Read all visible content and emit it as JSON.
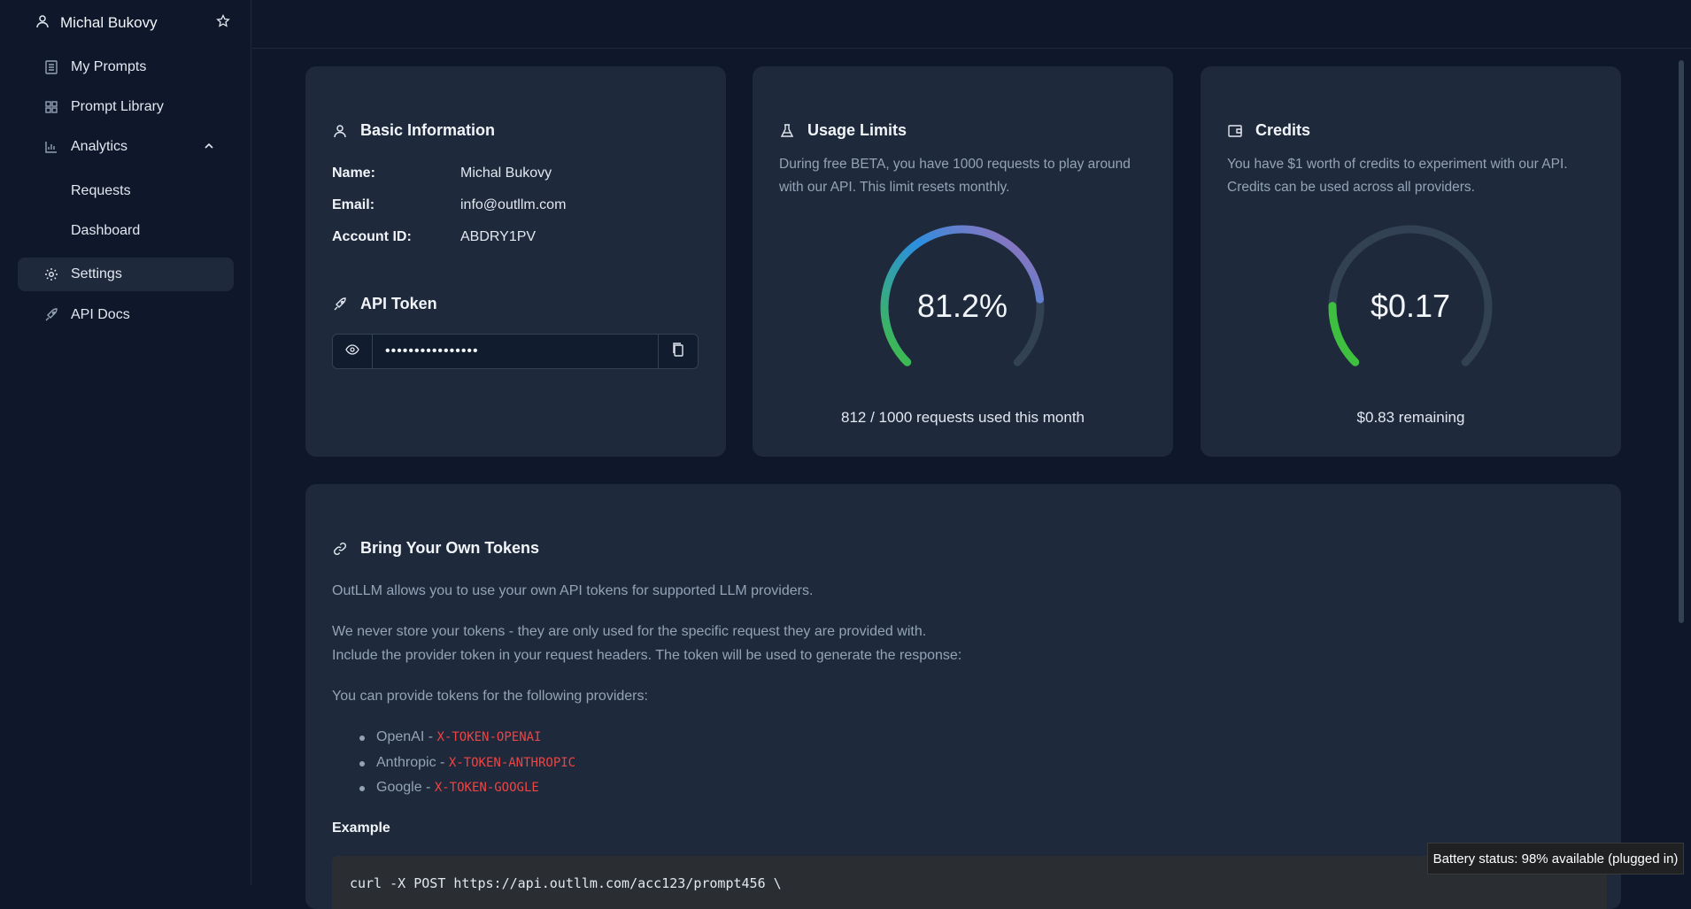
{
  "sidebar": {
    "user_name": "Michal Bukovy",
    "items": [
      {
        "label": "My Prompts",
        "icon": "document-icon"
      },
      {
        "label": "Prompt Library",
        "icon": "grid-icon"
      },
      {
        "label": "Analytics",
        "icon": "bar-chart-icon",
        "expanded": true
      },
      {
        "label": "Requests"
      },
      {
        "label": "Dashboard"
      },
      {
        "label": "Settings",
        "icon": "gear-icon",
        "active": true
      },
      {
        "label": "API Docs",
        "icon": "rocket-icon"
      }
    ]
  },
  "basic_info": {
    "title": "Basic Information",
    "name_label": "Name:",
    "name_value": "Michal Bukovy",
    "email_label": "Email:",
    "email_value": "info@outllm.com",
    "account_label": "Account ID:",
    "account_value": "ABDRY1PV",
    "api_token_title": "API Token",
    "api_token_value": "••••••••••••••••"
  },
  "usage": {
    "title": "Usage Limits",
    "description": "During free BETA, you have 1000 requests to play around with our API. This limit resets monthly.",
    "gauge_text": "81.2%",
    "gauge_fraction": 0.812,
    "footer": "812 / 1000 requests used this month"
  },
  "credits": {
    "title": "Credits",
    "description": "You have $1 worth of credits to experiment with our API. Credits can be used across all providers.",
    "gauge_text": "$0.17",
    "gauge_fraction": 0.17,
    "footer": "$0.83 remaining"
  },
  "byot": {
    "title": "Bring Your Own Tokens",
    "p1": "OutLLM allows you to use your own API tokens for supported LLM providers.",
    "p2": "We never store your tokens - they are only used for the specific request they are provided with.",
    "p3": "Include the provider token in your request headers. The token will be used to generate the response:",
    "p4": "You can provide tokens for the following providers:",
    "providers": [
      {
        "name": "OpenAI - ",
        "header": "X-TOKEN-OPENAI"
      },
      {
        "name": "Anthropic - ",
        "header": "X-TOKEN-ANTHROPIC"
      },
      {
        "name": "Google - ",
        "header": "X-TOKEN-GOOGLE"
      }
    ],
    "example_label": "Example",
    "code": "curl -X POST https://api.outllm.com/acc123/prompt456 \\"
  },
  "tooltip": "Battery status: 98% available (plugged in)",
  "colors": {
    "background": "#0f172a",
    "card": "#1e293b",
    "track": "#334155",
    "green": "#3fbf3f",
    "blue": "#2b8fe0",
    "code_red": "#ef4444"
  }
}
